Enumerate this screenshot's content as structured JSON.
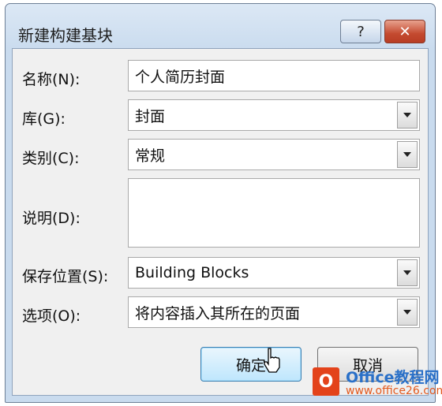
{
  "dialog": {
    "title": "新建构建基块",
    "help_glyph": "?",
    "close_glyph": "✕"
  },
  "fields": {
    "name": {
      "label": "名称(N):",
      "value": "个人简历封面"
    },
    "gallery": {
      "label": "库(G):",
      "value": "封面"
    },
    "category": {
      "label": "类别(C):",
      "value": "常规"
    },
    "description": {
      "label": "说明(D):",
      "value": ""
    },
    "save_in": {
      "label": "保存位置(S):",
      "value": "Building Blocks"
    },
    "options": {
      "label": "选项(O):",
      "value": "将内容插入其所在的页面"
    }
  },
  "buttons": {
    "ok": "确定",
    "cancel": "取消"
  },
  "watermark": {
    "logo_glyph": "O",
    "brand": "Office教程网",
    "url": "www.office26.com"
  }
}
